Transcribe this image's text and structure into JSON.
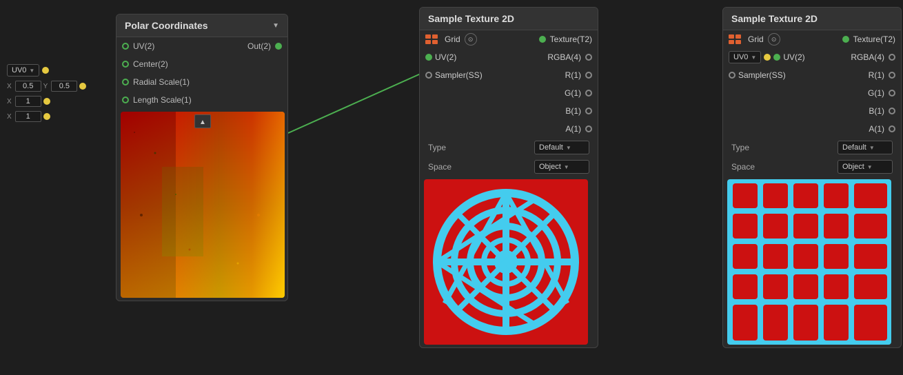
{
  "polar_node": {
    "title": "Polar Coordinates",
    "inputs": [
      {
        "label": "UV(2)",
        "connector_type": "green-empty"
      },
      {
        "label": "Center(2)",
        "connector_type": "green-empty"
      },
      {
        "label": "Radial Scale(1)",
        "connector_type": "green-empty"
      },
      {
        "label": "Length Scale(1)",
        "connector_type": "green-empty"
      }
    ],
    "output_label": "Out(2)",
    "uv_dropdown": "UV0",
    "center_x": "0.5",
    "center_y": "0.5",
    "radial_x": "1",
    "length_x": "1"
  },
  "sample_tex_1": {
    "title": "Sample Texture 2D",
    "grid_label": "Grid",
    "texture_label": "Texture(T2)",
    "uv_label": "UV(2)",
    "sampler_label": "Sampler(SS)",
    "rgba_label": "RGBA(4)",
    "r_label": "R(1)",
    "g_label": "G(1)",
    "b_label": "B(1)",
    "a_label": "A(1)",
    "type_label": "Type",
    "type_value": "Default",
    "space_label": "Space",
    "space_value": "Object"
  },
  "sample_tex_2": {
    "title": "Sample Texture 2D",
    "grid_label": "Grid",
    "texture_label": "Texture(T2)",
    "uv_label": "UV(2)",
    "sampler_label": "Sampler(SS)",
    "rgba_label": "RGBA(4)",
    "r_label": "R(1)",
    "g_label": "G(1)",
    "b_label": "B(1)",
    "a_label": "A(1)",
    "type_label": "Type",
    "type_value": "Default",
    "space_label": "Space",
    "space_value": "Object",
    "uv_dropdown": "UV0"
  }
}
